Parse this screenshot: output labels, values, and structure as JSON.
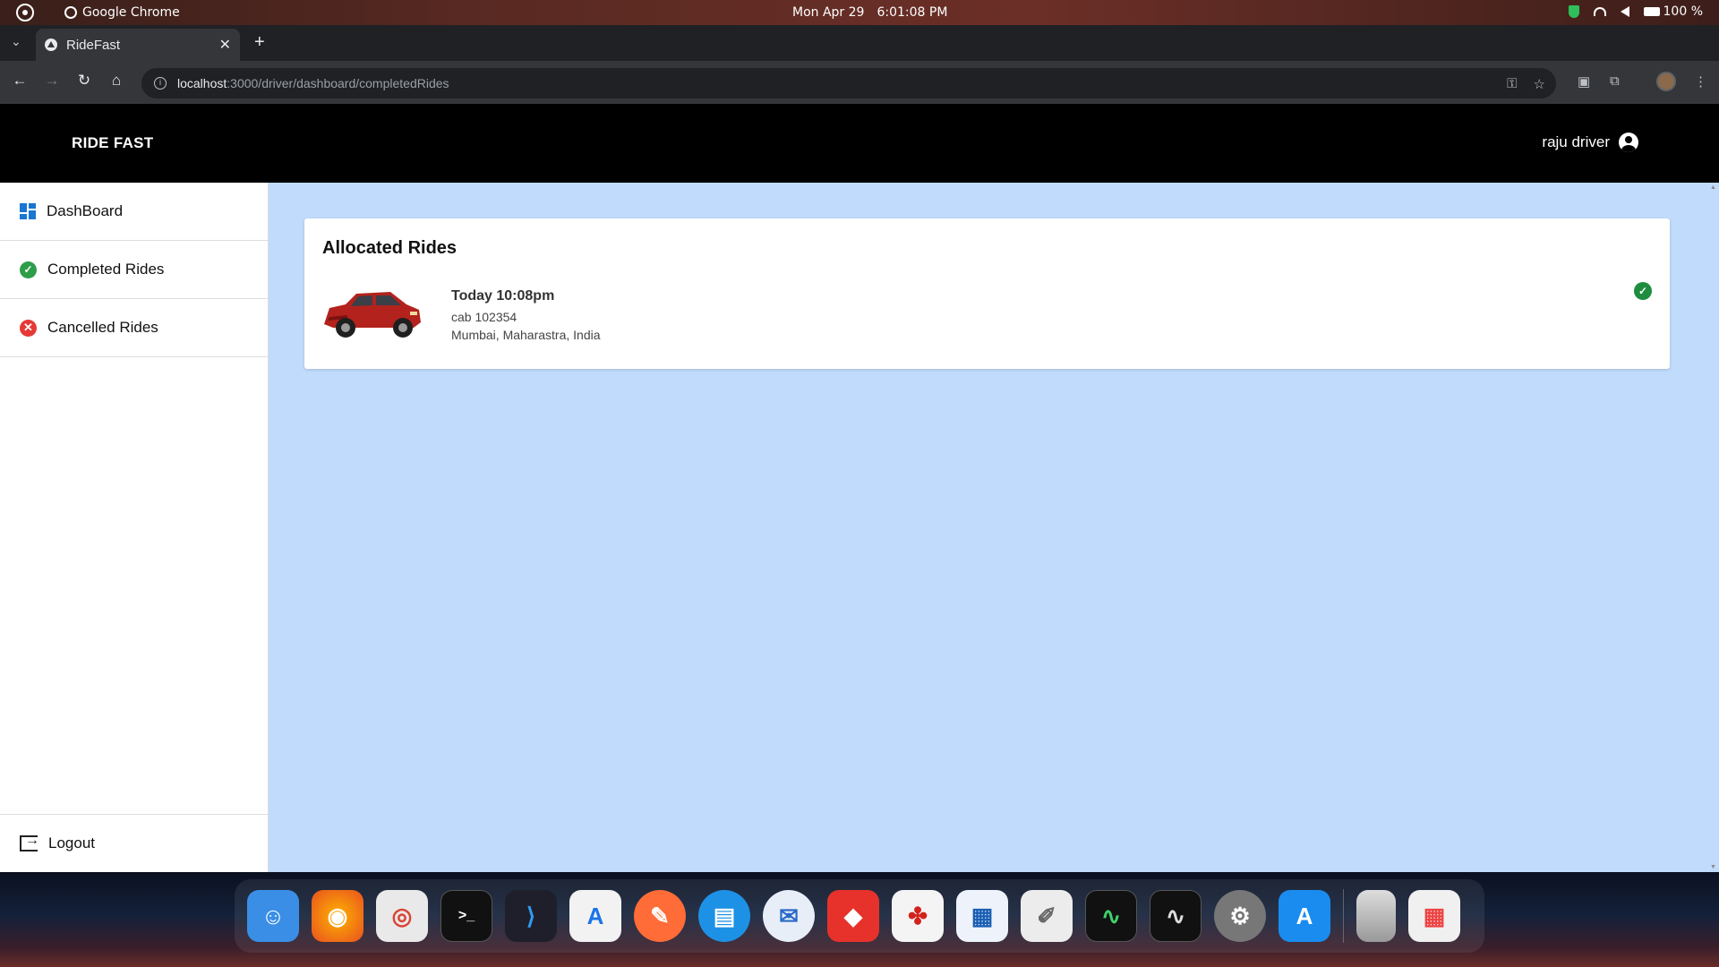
{
  "os": {
    "app_name": "Google Chrome",
    "date": "Mon Apr 29",
    "time": "6:01:08 PM",
    "battery": "100 %"
  },
  "browser": {
    "tab_title": "RideFast",
    "url_host": "localhost",
    "url_path": ":3000/driver/dashboard/completedRides"
  },
  "app": {
    "brand": "RIDE FAST",
    "user_name": "raju driver"
  },
  "sidebar": {
    "items": [
      {
        "label": "DashBoard",
        "icon": "dashboard-icon"
      },
      {
        "label": "Completed Rides",
        "icon": "check-circle-icon"
      },
      {
        "label": "Cancelled Rides",
        "icon": "cancel-circle-icon"
      }
    ],
    "logout_label": "Logout"
  },
  "main": {
    "card_title": "Allocated Rides",
    "ride": {
      "time": "Today 10:08pm",
      "cab": "cab 102354",
      "location": "Mumbai, Maharastra, India",
      "status_icon": "verified-check-icon"
    }
  },
  "colors": {
    "page_bg": "#c0dbfb",
    "header_bg": "#000000",
    "accent_blue": "#1976d2",
    "success_green": "#2e9d4a",
    "danger_red": "#e53935",
    "car_red": "#b3221c"
  },
  "dock": {
    "apps": [
      "finder-icon",
      "firefox-icon",
      "chrome-icon",
      "terminal-icon",
      "vscode-icon",
      "app-store-dev-icon",
      "postman-icon",
      "docker-icon",
      "thunderbird-icon",
      "anydesk-icon",
      "acrobat-icon",
      "text-editor-icon",
      "notes-icon",
      "activity-monitor-icon",
      "system-monitor-icon",
      "settings-icon",
      "app-updates-icon",
      "trash-icon",
      "launchpad-icon"
    ]
  }
}
